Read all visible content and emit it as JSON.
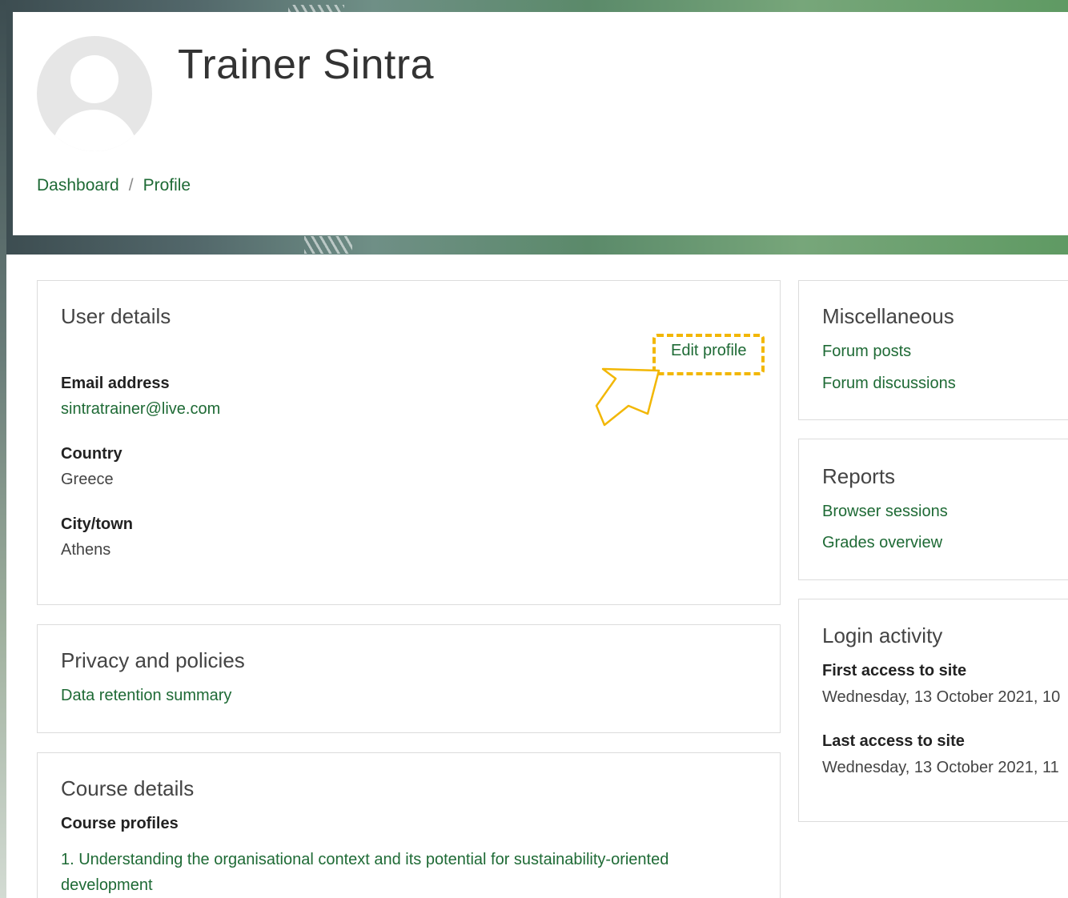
{
  "header": {
    "user_name": "Trainer Sintra",
    "breadcrumb": [
      {
        "label": "Dashboard"
      },
      {
        "label": "Profile"
      }
    ],
    "breadcrumb_separator": "/"
  },
  "user_details": {
    "title": "User details",
    "edit_profile_label": "Edit profile",
    "fields": [
      {
        "label": "Email address",
        "value": "sintratrainer@live.com"
      },
      {
        "label": "Country",
        "value": "Greece"
      },
      {
        "label": "City/town",
        "value": "Athens"
      }
    ]
  },
  "privacy": {
    "title": "Privacy and policies",
    "links": [
      {
        "label": "Data retention summary"
      }
    ]
  },
  "course_details": {
    "title": "Course details",
    "subtitle": "Course profiles",
    "courses": [
      {
        "label": "1. Understanding the organisational context and its potential for sustainability-oriented development"
      }
    ]
  },
  "miscellaneous": {
    "title": "Miscellaneous",
    "links": [
      {
        "label": "Forum posts"
      },
      {
        "label": "Forum discussions"
      }
    ]
  },
  "reports": {
    "title": "Reports",
    "links": [
      {
        "label": "Browser sessions"
      },
      {
        "label": "Grades overview"
      }
    ]
  },
  "login_activity": {
    "title": "Login activity",
    "first_access_label": "First access to site",
    "first_access_value": "Wednesday, 13 October 2021, 10",
    "last_access_label": "Last access to site",
    "last_access_value": "Wednesday, 13 October 2021, 11"
  },
  "colors": {
    "link": "#1e6a35",
    "highlight": "#f2b705",
    "avatar_bg": "#e6e6e6"
  },
  "icons": {
    "avatar": "default-user-avatar-icon",
    "pointer": "pointing-hand-icon"
  }
}
